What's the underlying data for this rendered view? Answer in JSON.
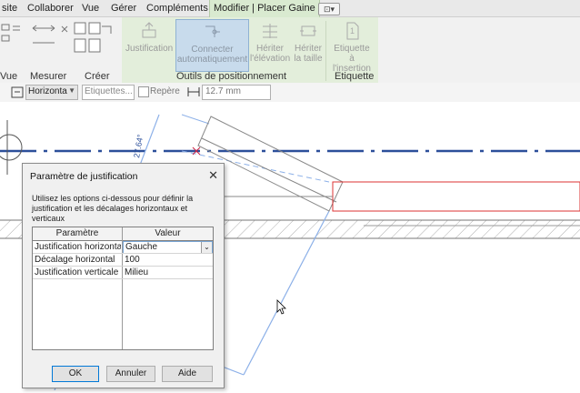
{
  "menu": {
    "tabs": [
      "site",
      "Collaborer",
      "Vue",
      "Gérer",
      "Compléments",
      "Modifier | Placer Gaine"
    ]
  },
  "ribbon": {
    "left_partial_label": "Vue",
    "measure_label": "Mesurer",
    "create_label": "Créer",
    "buttons": {
      "justification": "Justification",
      "connect_line1": "Connecter",
      "connect_line2": "automatiquement",
      "inherit_elev_line1": "Hériter",
      "inherit_elev_line2": "l'élévation",
      "inherit_size_line1": "Hériter",
      "inherit_size_line2": "la taille",
      "tag_line1": "Etiquette",
      "tag_line2": "à l'insertion"
    },
    "panels": {
      "positioning": "Outils de positionnement",
      "tag": "Etiquette"
    }
  },
  "optionsbar": {
    "orientation": "Horizonta",
    "tags_button": "Etiquettes...",
    "leader_label": "Repère",
    "leader_checked": false,
    "length_value": "12.7 mm"
  },
  "drawing": {
    "angle_text": "27.64°"
  },
  "dialog": {
    "title": "Paramètre de justification",
    "description": "Utilisez les options ci-dessous pour définir la justification et les décalages horizontaux et verticaux",
    "columns": [
      "Paramètre",
      "Valeur"
    ],
    "rows": [
      {
        "param": "Justification horizontal",
        "value": "Gauche"
      },
      {
        "param": "Décalage horizontal",
        "value": "100"
      },
      {
        "param": "Justification verticale",
        "value": "Milieu"
      }
    ],
    "ok": "OK",
    "cancel": "Annuler",
    "help": "Aide"
  }
}
